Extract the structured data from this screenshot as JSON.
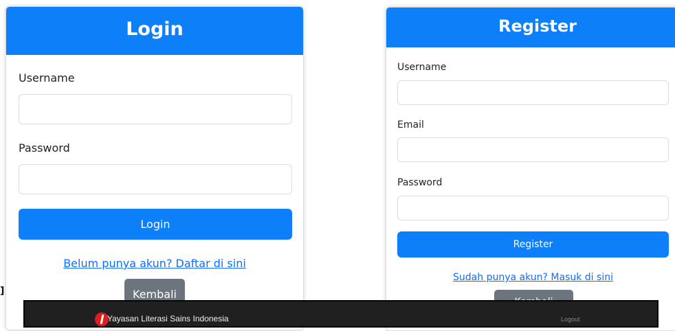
{
  "login": {
    "title": "Login",
    "username_label": "Username",
    "username_value": "",
    "password_label": "Password",
    "password_value": "",
    "submit_label": "Login",
    "register_link": "Belum punya akun? Daftar di sini",
    "back_label": "Kembali"
  },
  "register": {
    "title": "Register",
    "username_label": "Username",
    "username_value": "",
    "email_label": "Email",
    "email_value": "",
    "password_label": "Password",
    "password_value": "",
    "submit_label": "Register",
    "login_link": "Sudah punya akun? Masuk di sini",
    "back_label": "Kembali"
  },
  "footer": {
    "brand": "Yayasan Literasi Sains Indonesia",
    "logout_label": "Logout",
    "logo_icon": "yayasan-logo-icon"
  },
  "colors": {
    "primary": "#0d7ff8",
    "secondary": "#6c757d",
    "footer_bg": "#202020",
    "link": "#0d6efd"
  }
}
